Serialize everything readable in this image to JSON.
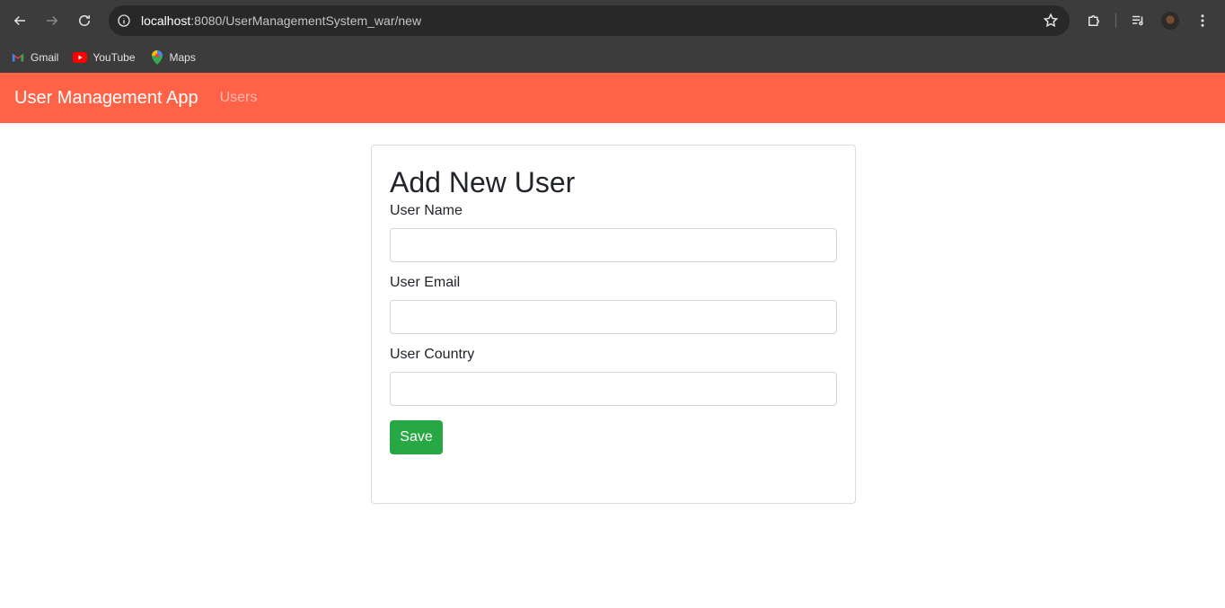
{
  "browser": {
    "url_host": "localhost",
    "url_rest": ":8080/UserManagementSystem_war/new",
    "bookmarks": [
      {
        "label": "Gmail",
        "icon": "gmail-icon"
      },
      {
        "label": "YouTube",
        "icon": "youtube-icon"
      },
      {
        "label": "Maps",
        "icon": "maps-icon"
      }
    ]
  },
  "navbar": {
    "brand": "User Management App",
    "link": "Users",
    "color": "#ff6347"
  },
  "form": {
    "title": "Add New User",
    "fields": [
      {
        "label": "User Name",
        "value": ""
      },
      {
        "label": "User Email",
        "value": ""
      },
      {
        "label": "User Country",
        "value": ""
      }
    ],
    "save_label": "Save",
    "save_color": "#28a745"
  }
}
